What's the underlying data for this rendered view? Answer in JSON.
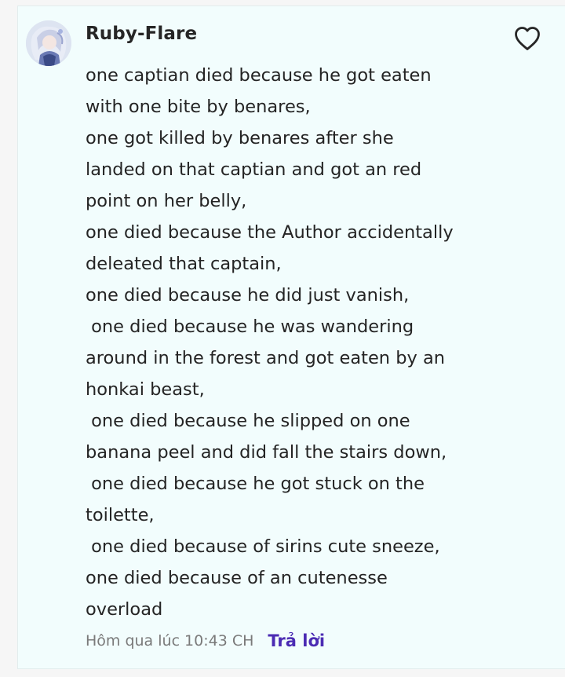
{
  "comment": {
    "author": "Ruby-Flare",
    "lines": [
      "one captian died because he got eaten",
      "with one bite by benares,",
      "one got killed by benares after she",
      "landed on that captian and got an red",
      "point on her belly,",
      "one died because the Author accidentally",
      "deleated that captain,",
      "one died because he did just vanish,",
      " one died because he was wandering",
      "around in the forest and got eaten by an",
      "honkai beast,",
      " one died because he slipped on one",
      "banana peel and did fall the stairs down,",
      " one died because he got stuck on the",
      "toilette,",
      " one died because of sirins cute sneeze,",
      "one died because of an cutenesse",
      "overload"
    ],
    "timestamp": "Hôm qua lúc 10:43 CH",
    "reply_label": "Trả lời"
  },
  "icons": {
    "like": "heart-outline-icon"
  },
  "colors": {
    "card_background": "#f2fdfd",
    "reply_accent": "#4b2bb3",
    "timestamp": "#7a7a7a"
  }
}
